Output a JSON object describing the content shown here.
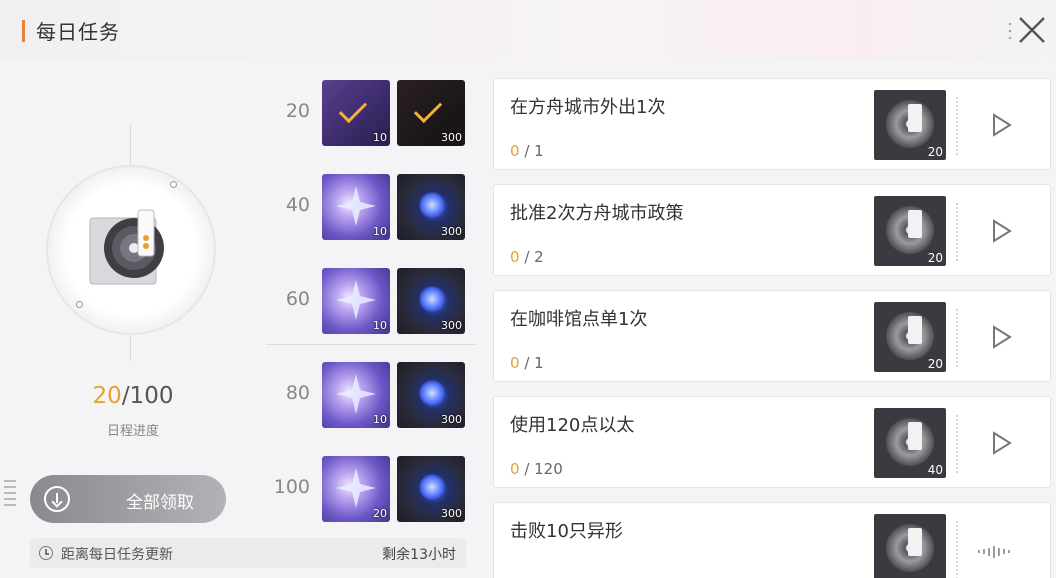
{
  "header": {
    "title": "每日任务"
  },
  "left": {
    "progress_current": "20",
    "progress_total": "/100",
    "progress_label": "日程进度",
    "claim_all_label": "全部领取",
    "refresh_label": "距离每日任务更新",
    "remaining_label": "剩余13小时"
  },
  "milestones": [
    {
      "value": "20",
      "reward1_count": "10",
      "reward2_count": "300",
      "claimed": true
    },
    {
      "value": "40",
      "reward1_count": "10",
      "reward2_count": "300",
      "claimed": false
    },
    {
      "value": "60",
      "reward1_count": "10",
      "reward2_count": "300",
      "claimed": false
    },
    {
      "value": "80",
      "reward1_count": "10",
      "reward2_count": "300",
      "claimed": false
    },
    {
      "value": "100",
      "reward1_count": "20",
      "reward2_count": "300",
      "claimed": false
    }
  ],
  "tasks": [
    {
      "name": "在方舟城市外出1次",
      "done": "0",
      "total": " / 1",
      "reward_count": "20"
    },
    {
      "name": "批准2次方舟城市政策",
      "done": "0",
      "total": " / 2",
      "reward_count": "20"
    },
    {
      "name": "在咖啡馆点单1次",
      "done": "0",
      "total": " / 1",
      "reward_count": "20"
    },
    {
      "name": "使用120点以太",
      "done": "0",
      "total": " / 120",
      "reward_count": "40"
    },
    {
      "name": "击败10只异形",
      "done": "",
      "total": "",
      "reward_count": ""
    }
  ],
  "colors": {
    "accent": "#e8823a",
    "progress": "#e8a030",
    "reward_gold": "#f2b23b"
  },
  "icons": {
    "close": "close-icon",
    "go": "play-arrow-icon",
    "clock": "clock-icon",
    "claim": "download-arrow-icon"
  }
}
